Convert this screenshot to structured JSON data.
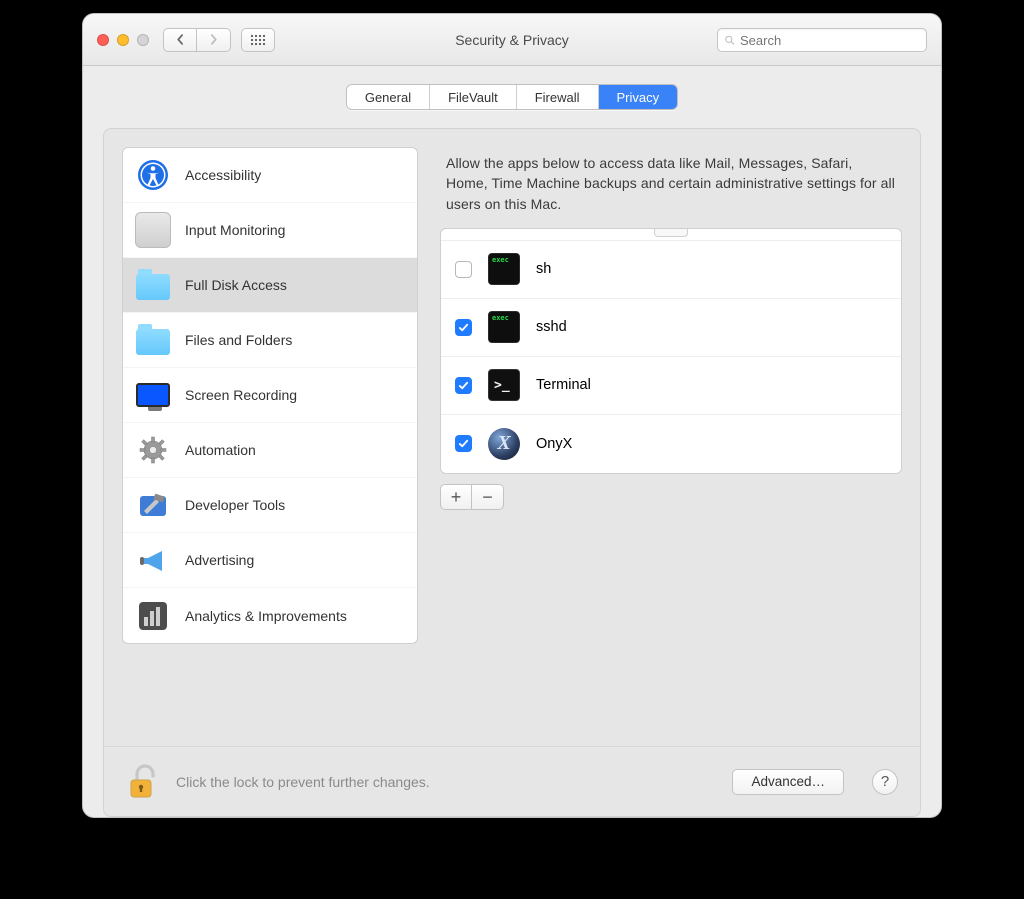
{
  "window": {
    "title": "Security & Privacy"
  },
  "search": {
    "placeholder": "Search"
  },
  "tabs": [
    {
      "label": "General",
      "active": false
    },
    {
      "label": "FileVault",
      "active": false
    },
    {
      "label": "Firewall",
      "active": false
    },
    {
      "label": "Privacy",
      "active": true
    }
  ],
  "sidebar": {
    "items": [
      {
        "label": "Accessibility",
        "icon": "accessibility-icon",
        "selected": false
      },
      {
        "label": "Input Monitoring",
        "icon": "keyboard-icon",
        "selected": false
      },
      {
        "label": "Full Disk Access",
        "icon": "folder-icon",
        "selected": true
      },
      {
        "label": "Files and Folders",
        "icon": "folder-icon",
        "selected": false
      },
      {
        "label": "Screen Recording",
        "icon": "display-icon",
        "selected": false
      },
      {
        "label": "Automation",
        "icon": "gear-icon",
        "selected": false
      },
      {
        "label": "Developer Tools",
        "icon": "hammer-icon",
        "selected": false
      },
      {
        "label": "Advertising",
        "icon": "megaphone-icon",
        "selected": false
      },
      {
        "label": "Analytics & Improvements",
        "icon": "barchart-icon",
        "selected": false
      }
    ]
  },
  "main": {
    "description": "Allow the apps below to access data like Mail, Messages, Safari, Home, Time Machine backups and certain administrative settings for all users on this Mac.",
    "apps": [
      {
        "name": "sh",
        "checked": false,
        "icon": "exec-icon"
      },
      {
        "name": "sshd",
        "checked": true,
        "icon": "exec-icon"
      },
      {
        "name": "Terminal",
        "checked": true,
        "icon": "terminal-icon"
      },
      {
        "name": "OnyX",
        "checked": true,
        "icon": "onyx-icon"
      }
    ],
    "add_label": "+",
    "remove_label": "−"
  },
  "footer": {
    "lock_hint": "Click the lock to prevent further changes.",
    "advanced_label": "Advanced…",
    "help_label": "?"
  }
}
